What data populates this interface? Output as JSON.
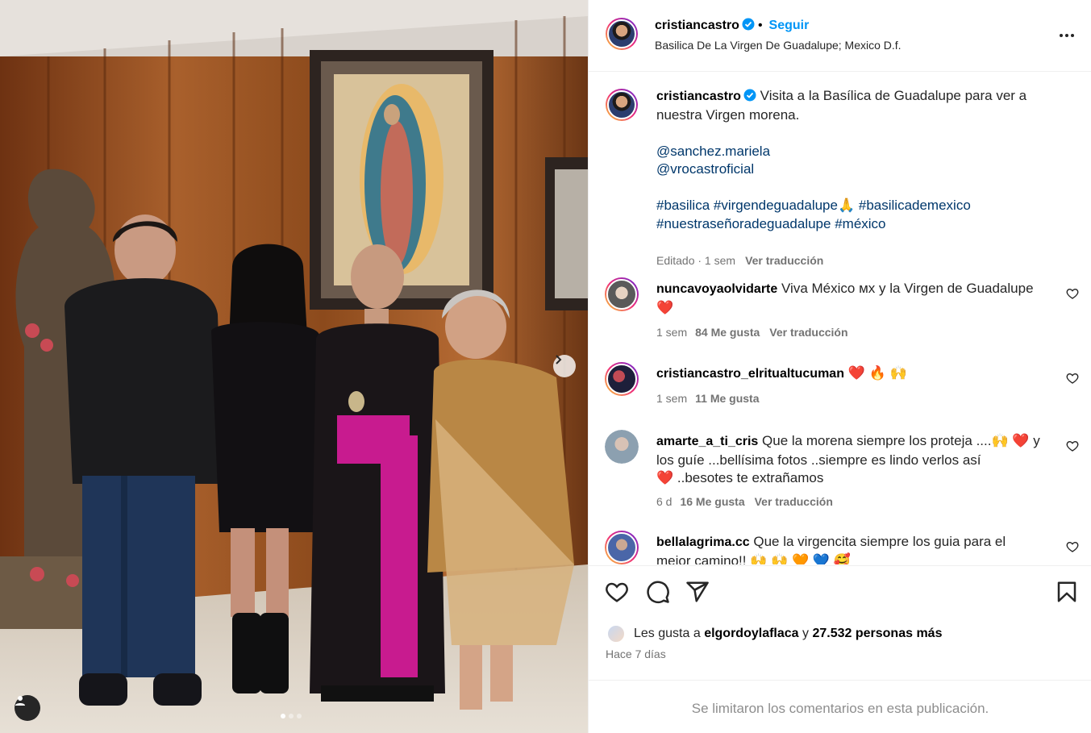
{
  "post": {
    "author": "cristiancastro",
    "follow_label": "Seguir",
    "separator": "•",
    "location": "Basilica De La Virgen De Guadalupe; Mexico D.f.",
    "caption_line1": "Visita a la Basílica de Guadalupe para ver a",
    "caption_line2": "nuestra Virgen morena.",
    "mentions": [
      "@sanchez.mariela",
      "@vrocastroficial"
    ],
    "hashtags_line1": [
      "#basilica",
      "#virgendeguadalupe🙏",
      "#basilicademexico"
    ],
    "hashtags_line2": [
      "#nuestraseñoradeguadalupe",
      "#méxico"
    ],
    "caption_time": "Editado · 1 sem",
    "translate_label": "Ver traducción",
    "carousel_total": 3,
    "carousel_index": 1
  },
  "comments": [
    {
      "username": "nuncavoyaolvidarte",
      "text_line1": "Viva México ᴍx y la Virgen de Guadalupe",
      "text_line2": "❤️",
      "time": "1 sem",
      "likes": "84 Me gusta",
      "translate": "Ver traducción"
    },
    {
      "username": "cristiancastro_elritualtucuman",
      "text_line1": "❤️ 🔥 🙌",
      "time": "1 sem",
      "likes": "11 Me gusta"
    },
    {
      "username": "amarte_a_ti_cris",
      "text_line1": "Que la morena siempre los proteja ....🙌 ❤️ y",
      "text_line2": "los guíe ...bellísima fotos ..siempre es lindo verlos así",
      "text_line3": "❤️ ..besotes te extrañamos",
      "time": "6 d",
      "likes": "16 Me gusta",
      "translate": "Ver traducción"
    },
    {
      "username": "bellalagrima.cc",
      "text_line1": "Que la virgencita siempre los guia para el",
      "text_line2": "mejor camino!! 🙌 🙌 🧡 💙 🥰"
    }
  ],
  "likes": {
    "prefix": "Les gusta a",
    "user": "elgordoylaflaca",
    "conj": "y",
    "others": "27.532 personas más"
  },
  "posted": "Hace 7 días",
  "footer_note": "Se limitaron los comentarios en esta publicación.",
  "icons": [
    "verified-badge-icon",
    "more-options-icon",
    "heart-icon",
    "comment-icon",
    "share-icon",
    "bookmark-icon",
    "chevron-right-icon",
    "user-tag-icon"
  ],
  "colors": {
    "link": "#00376b",
    "follow": "#0095f6",
    "verified": "#0095f6",
    "like_heart": "#ed4956",
    "muted": "#737373"
  }
}
